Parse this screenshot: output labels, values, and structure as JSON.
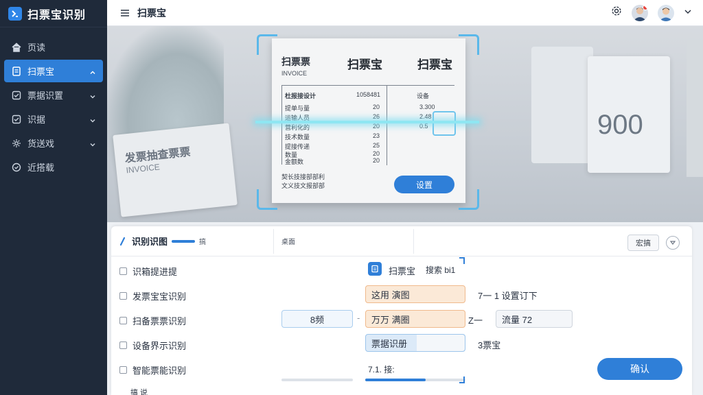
{
  "app": {
    "title": "扫票宝识别"
  },
  "sidebar": {
    "items": [
      {
        "label": "页读",
        "icon": "home-icon"
      },
      {
        "label": "扫票宝",
        "icon": "invoice-icon",
        "active": true
      },
      {
        "label": "票据识置",
        "icon": "doc-check-icon"
      },
      {
        "label": "识据",
        "icon": "check-square-icon"
      },
      {
        "label": "货送戏",
        "icon": "settings-spark-icon"
      },
      {
        "label": "近搭载",
        "icon": "check-circle-icon"
      }
    ]
  },
  "header": {
    "title": "扫票宝"
  },
  "receipt": {
    "title_left": "扫票票",
    "subtitle": "INVOICE",
    "title_mid": "扫票宝",
    "title_right": "扫票宝",
    "rows": [
      {
        "a": "杜报接设计",
        "b": "1058481",
        "c": "设备"
      },
      {
        "a": "提单与量",
        "b": "20",
        "c": "3.300"
      },
      {
        "a": "运输人员",
        "b": "26",
        "c": "2.48"
      },
      {
        "a": "营利化的",
        "b": "20",
        "c": "0.5"
      },
      {
        "a": "技术数量",
        "b": "23"
      },
      {
        "a": "提接传递",
        "b": "25"
      },
      {
        "a": "数量",
        "b": "20"
      },
      {
        "a": "金额数",
        "b": "20"
      }
    ],
    "footer_line1": "契长技接部部利",
    "footer_line2": "文义技文报部部",
    "button": "设置"
  },
  "background": {
    "paper_title": "发票抽查票票",
    "paper_sub": "INVOICE",
    "card_value": "900"
  },
  "panel": {
    "title": "识别识图",
    "title_small": "搞",
    "mid_label": "桌面",
    "button": "宏搞",
    "options": [
      "识箱提进提",
      "发票宝宝识别",
      "扫备票票识别",
      "设备界示识别",
      "智能票能识别"
    ],
    "footer_partial": "搞   说",
    "brand_icon": "invoice-icon",
    "brand_label": "扫票宝",
    "brand_sub": "搜索 bi1",
    "field_orange1": "这用 演图",
    "field_orange2": "万万 满圈",
    "field_blue": "票据识册",
    "field_left": "8频",
    "text_r1": "7一 1  设置订下",
    "text_r2": "Z一",
    "field_right": "流量 72",
    "text_r4": "3票宝",
    "slider_label": "7.1. 接:",
    "slider_value": 0.6,
    "confirm": "确认"
  }
}
